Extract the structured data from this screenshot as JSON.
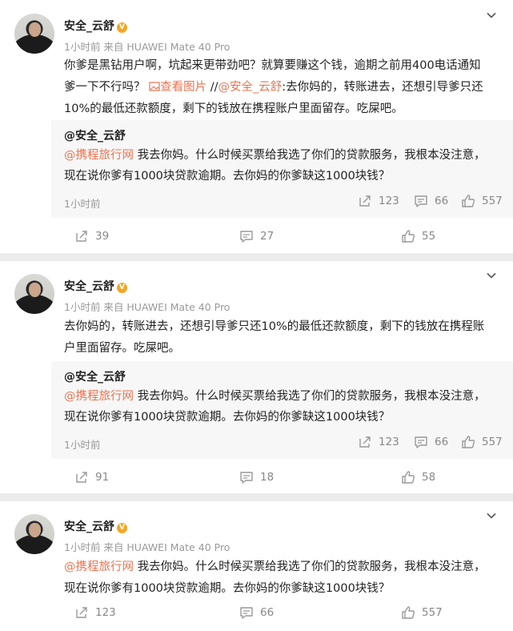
{
  "posts": [
    {
      "author": "安全_云舒",
      "meta": "1小时前  来自 HUAWEI Mate 40 Pro",
      "text_pre": "你爹是黑钻用户啊，坑起来更带劲吧？就算要赚这个钱，逾期之前用400电话通知爹一下不行吗？",
      "view_image": "查看图片",
      "slash": " //",
      "mention": "@安全_云舒",
      "text_post": ":去你妈的，转账进去，还想引导爹只还10%的最低还款额度，剩下的钱放在携程账户里面留存。吃屎吧。",
      "repost": {
        "author": "@安全_云舒",
        "mention": "@携程旅行网",
        "text": " 我去你妈。什么时候买票给我选了你们的贷款服务，我根本没注意，现在说你爹有1000块贷款逾期。去你妈的你爹缺这1000块钱？",
        "time": "1小时前",
        "reposts": "123",
        "comments": "66",
        "likes": "557"
      },
      "reposts": "39",
      "comments": "27",
      "likes": "55"
    },
    {
      "author": "安全_云舒",
      "meta": "1小时前  来自 HUAWEI Mate 40 Pro",
      "text": "去你妈的，转账进去，还想引导爹只还10%的最低还款额度，剩下的钱放在携程账户里面留存。吃屎吧。",
      "repost": {
        "author": "@安全_云舒",
        "mention": "@携程旅行网",
        "text": " 我去你妈。什么时候买票给我选了你们的贷款服务，我根本没注意，现在说你爹有1000块贷款逾期。去你妈的你爹缺这1000块钱？",
        "time": "1小时前",
        "reposts": "123",
        "comments": "66",
        "likes": "557"
      },
      "reposts": "91",
      "comments": "18",
      "likes": "58"
    },
    {
      "author": "安全_云舒",
      "meta": "1小时前  来自 HUAWEI Mate 40 Pro",
      "mention": "@携程旅行网",
      "text": " 我去你妈。什么时候买票给我选了你们的贷款服务，我根本没注意，现在说你爹有1000块贷款逾期。去你妈的你爹缺这1000块钱？",
      "reposts": "123",
      "comments": "66",
      "likes": "557"
    }
  ],
  "badge_letter": "V",
  "icons": {
    "repost": "share-arrow-icon",
    "comment": "comment-bubble-icon",
    "like": "thumbs-up-icon",
    "more": "chevron-down-icon",
    "image": "image-icon"
  },
  "colors": {
    "link": "#eb7350",
    "background": "#ececec",
    "repost_bg": "#f7f7f7"
  }
}
